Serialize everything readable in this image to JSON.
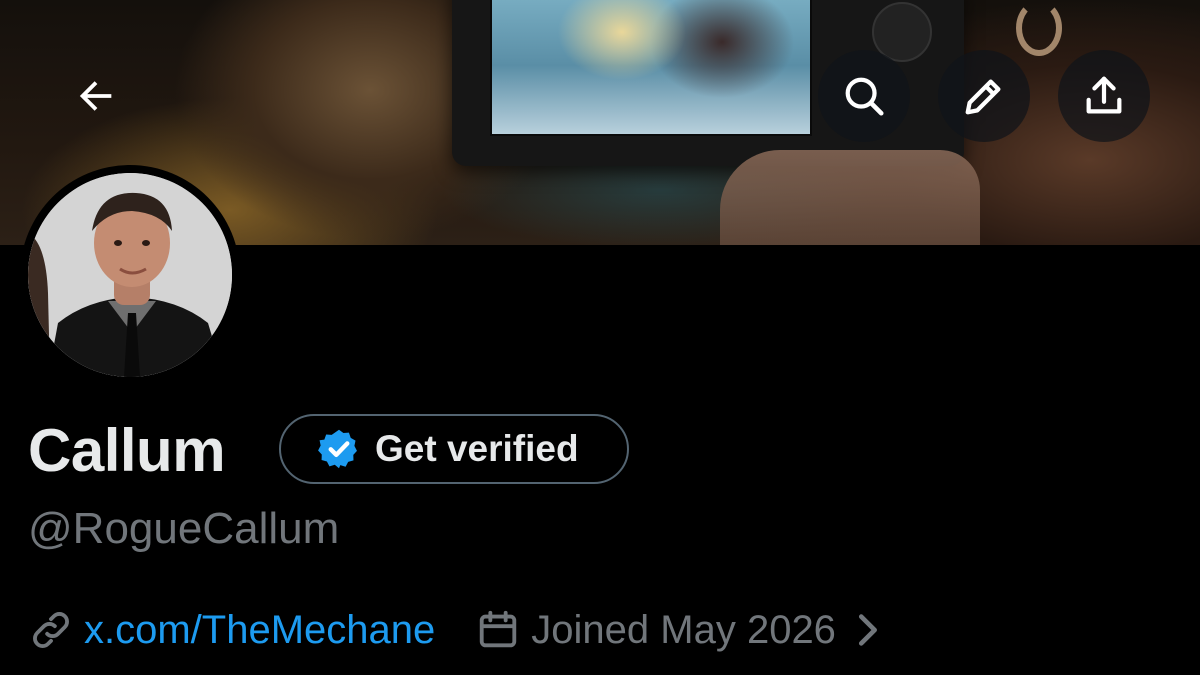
{
  "nav": {
    "back_icon": "arrow-left-icon",
    "search_icon": "search-icon",
    "edit_icon": "pencil-icon",
    "share_icon": "share-upload-icon"
  },
  "profile": {
    "display_name": "Callum",
    "verify_button_label": "Get verified",
    "handle": "@RogueCallum",
    "website": "x.com/TheMechane",
    "joined": "Joined May 2026"
  },
  "colors": {
    "background": "#000000",
    "text_primary": "#e7e9ea",
    "text_secondary": "#71767b",
    "link": "#1d9bf0",
    "verified_badge": "#1d9bf0",
    "pill_border": "#536471"
  }
}
